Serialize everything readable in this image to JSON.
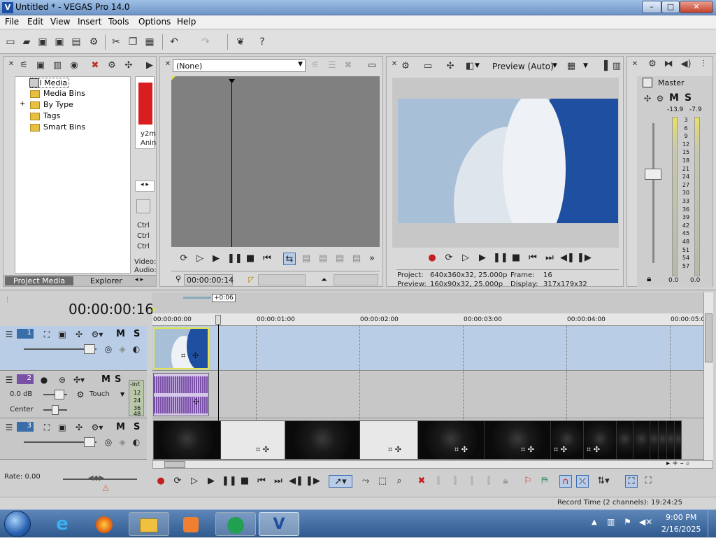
{
  "window": {
    "title": "Untitled * - VEGAS Pro 14.0",
    "app_icon": "vegas-icon",
    "minimize": "–",
    "maximize": "□",
    "close": "✕"
  },
  "menu": [
    "File",
    "Edit",
    "View",
    "Insert",
    "Tools",
    "Options",
    "Help"
  ],
  "project_media": {
    "tree": [
      "All Media",
      "Media Bins",
      "By Type",
      "Tags",
      "Smart Bins"
    ],
    "expand": "+",
    "thumb_lines": [
      "y2m",
      "Anin"
    ],
    "ctrl_lines": [
      "Ctrl",
      "Ctrl",
      "Ctrl"
    ],
    "info_lines": [
      "Video:",
      "Audio:"
    ],
    "tabs": [
      "Project Media",
      "Explorer"
    ]
  },
  "trimmer": {
    "dropdown_value": "(None)",
    "timecode": "00:00:00:14"
  },
  "preview": {
    "mode": "Preview (Auto)",
    "project_label": "Project:",
    "project_value": "640x360x32, 25.000p",
    "preview_label": "Preview:",
    "preview_value": "160x90x32, 25.000p",
    "frame_label": "Frame:",
    "frame_value": "16",
    "display_label": "Display:",
    "display_value": "317x179x32"
  },
  "master": {
    "label": "Master",
    "m": "M",
    "s": "S",
    "peak_left": "-13.9",
    "peak_right": "-7.9",
    "ticks": [
      "3",
      "6",
      "9",
      "12",
      "15",
      "18",
      "21",
      "24",
      "27",
      "30",
      "33",
      "36",
      "39",
      "42",
      "45",
      "48",
      "51",
      "54",
      "57"
    ],
    "bottom_left": "0.0",
    "bottom_right": "0.0"
  },
  "timeline": {
    "time_display": "00:00:00:16",
    "cursor_badge": "+0:06",
    "ruler": [
      "00:00:00:00",
      "00:00:01:00",
      "00:00:02:00",
      "00:00:03:00",
      "00:00:04:00",
      "00:00:05:0"
    ],
    "tracks": [
      {
        "number": "1",
        "m": "M",
        "s": "S"
      },
      {
        "number": "2",
        "m": "M",
        "s": "S",
        "volume": "0.0 dB",
        "mode": "Touch",
        "pan": "Center",
        "meter": [
          "-Inf.",
          "12",
          "24",
          "36",
          "48"
        ]
      },
      {
        "number": "3",
        "m": "M",
        "s": "S"
      }
    ],
    "rate": "Rate: 0.00"
  },
  "status": {
    "record_time": "Record Time (2 channels): 19:24:25"
  },
  "taskbar": {
    "time": "9:00 PM",
    "date": "2/16/2025"
  },
  "colors": {
    "title_bar": "#7da2d4",
    "video_track": "#b9cde6",
    "audio_track": "#c7c7c7",
    "audio_wave": "#7a4fa6",
    "selection": "#e4e44a",
    "taskbar": "#3f6aa0"
  }
}
